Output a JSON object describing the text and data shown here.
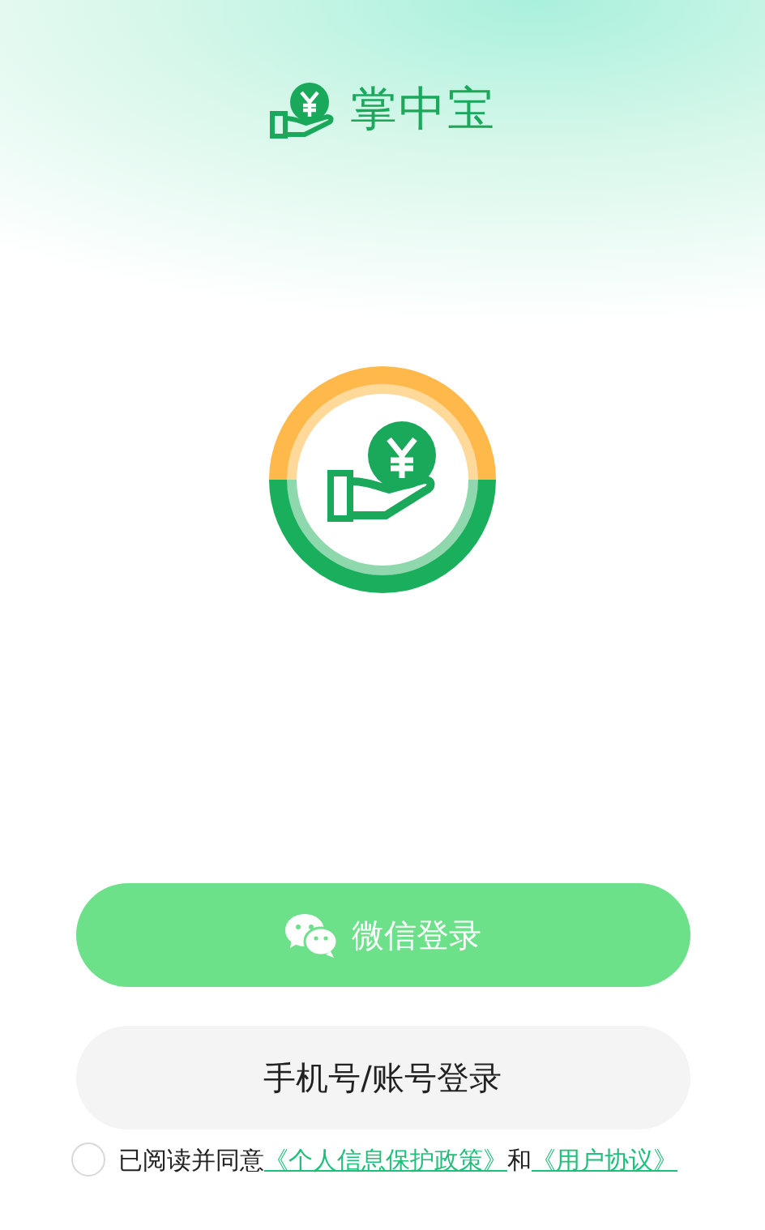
{
  "app_name": "掌中宝",
  "buttons": [
    {
      "kind": "wechat",
      "label": "微信登录"
    },
    {
      "kind": "phone",
      "label": "手机号/账号登录"
    }
  ],
  "agreement": {
    "checked": false,
    "text": "已阅读并同意",
    "links": [
      "《个人信息保护政策》",
      "《用户协议》"
    ],
    "joiner": "和"
  }
}
